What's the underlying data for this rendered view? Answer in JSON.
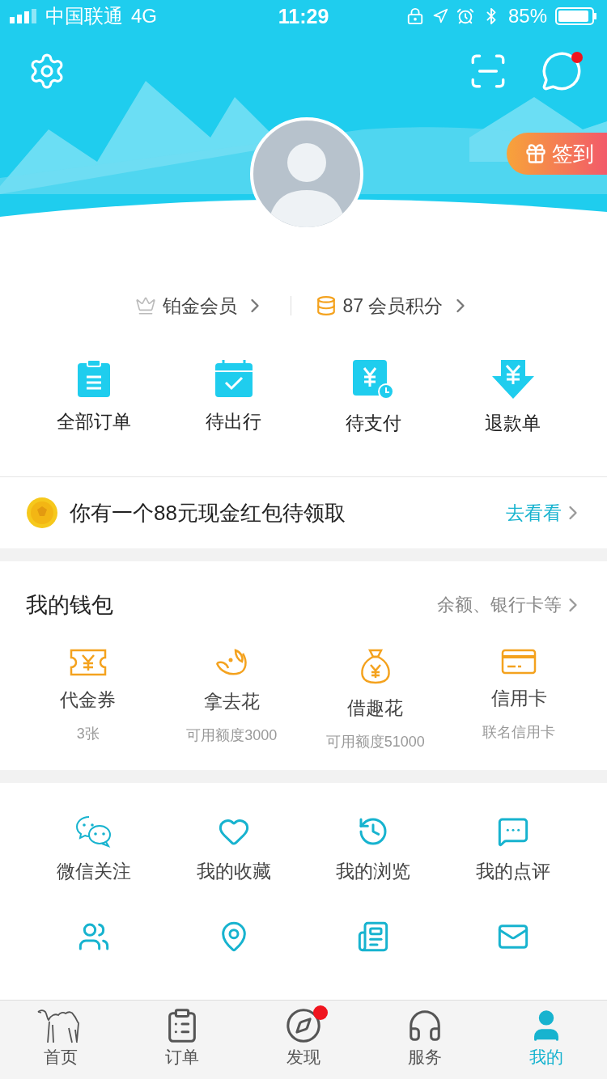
{
  "status_bar": {
    "carrier": "中国联通",
    "network": "4G",
    "time": "11:29",
    "battery": "85%"
  },
  "header": {
    "messages_badge": true,
    "checkin": "签到"
  },
  "member": {
    "level": "铂金会员",
    "points": "87 会员积分"
  },
  "orders": [
    {
      "kind": "clipboard",
      "label": "全部订单"
    },
    {
      "kind": "calendar",
      "label": "待出行"
    },
    {
      "kind": "pay",
      "label": "待支付"
    },
    {
      "kind": "refund",
      "label": "退款单"
    }
  ],
  "banner": {
    "text": "你有一个88元现金红包待领取",
    "link": "去看看"
  },
  "wallet": {
    "title": "我的钱包",
    "more": "余额、银行卡等",
    "items": [
      {
        "kind": "ticket",
        "label": "代金券",
        "sub": "3张"
      },
      {
        "kind": "loan",
        "label": "拿去花",
        "sub": "可用额度3000"
      },
      {
        "kind": "bag",
        "label": "借趣花",
        "sub": "可用额度51000"
      },
      {
        "kind": "card",
        "label": "信用卡",
        "sub": "联名信用卡"
      }
    ]
  },
  "services": [
    {
      "kind": "chat",
      "label": "微信关注"
    },
    {
      "kind": "heart",
      "label": "我的收藏"
    },
    {
      "kind": "history",
      "label": "我的浏览"
    },
    {
      "kind": "comment",
      "label": "我的点评"
    },
    {
      "kind": "users"
    },
    {
      "kind": "pin"
    },
    {
      "kind": "invoice"
    },
    {
      "kind": "mail"
    }
  ],
  "tabs": [
    {
      "kind": "camel",
      "label": "首页",
      "selected": false,
      "badge": false
    },
    {
      "kind": "list",
      "label": "订单",
      "selected": false,
      "badge": false
    },
    {
      "kind": "compass",
      "label": "发现",
      "selected": false,
      "badge": true
    },
    {
      "kind": "headset",
      "label": "服务",
      "selected": false,
      "badge": false
    },
    {
      "kind": "user",
      "label": "我的",
      "selected": true,
      "badge": false
    }
  ]
}
